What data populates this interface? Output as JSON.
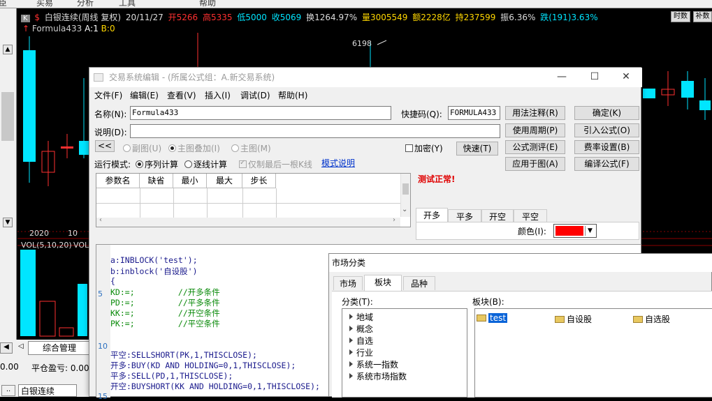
{
  "top_strip": {
    "items": [
      "臣",
      "买易",
      "分析",
      "工具",
      "帮助"
    ]
  },
  "quote": {
    "k_label": "K",
    "icon": "dollar-icon",
    "name": "白银连续(周线 复权)",
    "date": "20/11/27",
    "open": "开5266",
    "high": "高5335",
    "low": "低5000",
    "close": "收5069",
    "turnover": "换1264.97%",
    "volume": "量3005549",
    "amount": "额2228亿",
    "hold": "持237599",
    "amplitude": "振6.36%",
    "change": "跌(191)3.63%",
    "btn_share": "时数",
    "btn_fill": "补数"
  },
  "formula_line": {
    "name": "Formula433",
    "a": "A:1",
    "b": "B:0"
  },
  "chart": {
    "price_label": "6198",
    "year_label": "2020",
    "month_label": "10",
    "vol_label": "VOL(5,10,20)",
    "vol_suffix": "VOL"
  },
  "bottom": {
    "tab_label": "综合管理",
    "pnl_prefix": "0.00",
    "pnl_label": "平仓盈亏: 0.00",
    "stock_name": "白银连续",
    "dots": ".."
  },
  "dialog": {
    "title": "交易系统编辑 - (所属公式组：A.新交易系统)",
    "menu": [
      "文件(F)",
      "编辑(E)",
      "查看(V)",
      "插入(I)",
      "调试(D)",
      "帮助(H)"
    ],
    "name_label": "名称(N):",
    "name_value": "Formula433",
    "shortcut_label": "快捷码(Q):",
    "shortcut_value": "FORMULA433",
    "desc_label": "说明(D):",
    "desc_value": "",
    "collapse": "<<",
    "radio_sub": "副图(U)",
    "radio_overlay": "主图叠加(I)",
    "radio_main": "主图(M)",
    "encrypt": "加密(Y)",
    "fast": "快速(T)",
    "run_mode_label": "运行模式:",
    "run_seq": "序列计算",
    "run_tick": "逐线计算",
    "last_bar_only": "仅制最后一根K线",
    "mode_link": "模式说明",
    "buttons": {
      "usage": "用法注释(R)",
      "period": "使用周期(P)",
      "test": "公式测评(E)",
      "apply": "应用于图(A)",
      "ok": "确定(K)",
      "import": "引入公式(O)",
      "fee": "费率设置(B)",
      "compile": "编译公式(F)"
    },
    "test_result": "测试正常!",
    "param_headers": [
      "参数名",
      "缺省",
      "最小",
      "最大",
      "步长"
    ],
    "signal_tabs": [
      "开多",
      "平多",
      "开空",
      "平空"
    ],
    "color_label": "颜色(I):",
    "color_value": "#ff0000",
    "line_numbers": [
      "5",
      "10",
      "15"
    ],
    "code": [
      {
        "text": "a:INBLOCK('test');",
        "cls": ""
      },
      {
        "text": "b:inblock('自设股')",
        "cls": ""
      },
      {
        "text": "{",
        "cls": ""
      },
      {
        "text": "KD:=;         //开多条件",
        "cls": "green"
      },
      {
        "text": "PD:=;         //平多条件",
        "cls": "green"
      },
      {
        "text": "KK:=;         //开空条件",
        "cls": "green"
      },
      {
        "text": "PK:=;         //平空条件",
        "cls": "green"
      },
      {
        "text": "",
        "cls": ""
      },
      {
        "text": "",
        "cls": ""
      },
      {
        "text": "平空:SELLSHORT(PK,1,THISCLOSE);",
        "cls": ""
      },
      {
        "text": "开多:BUY(KD AND HOLDING=0,1,THISCLOSE);",
        "cls": ""
      },
      {
        "text": "平多:SELL(PD,1,THISCLOSE);",
        "cls": ""
      },
      {
        "text": "开空:BUYSHORT(KK AND HOLDING=0,1,THISCLOSE);",
        "cls": ""
      }
    ]
  },
  "market_dialog": {
    "title": "市场分类",
    "tabs": [
      "市场",
      "板块",
      "品种"
    ],
    "cat_label": "分类(T):",
    "block_label": "板块(B):",
    "categories": [
      "地域",
      "概念",
      "自选",
      "行业",
      "系统一指数",
      "系统市场指数"
    ],
    "blocks": [
      "test",
      "自设股",
      "自选股"
    ]
  }
}
